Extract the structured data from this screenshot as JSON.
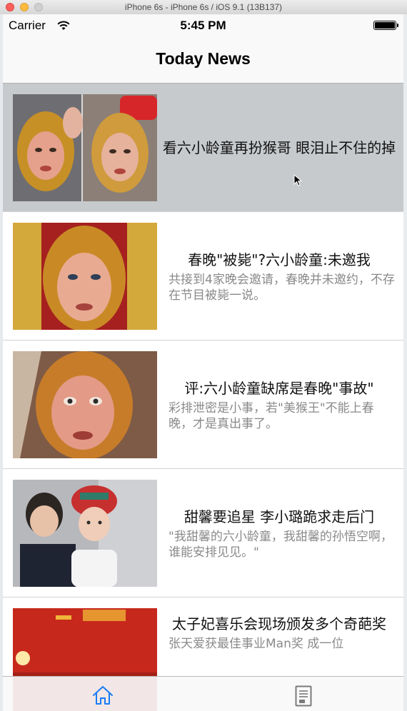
{
  "window": {
    "title": "iPhone 6s - iPhone 6s / iOS 9.1 (13B137)"
  },
  "status_bar": {
    "carrier": "Carrier",
    "time": "5:45 PM"
  },
  "nav": {
    "title": "Today News"
  },
  "news": [
    {
      "title": "看六小龄童再扮猴哥 眼泪止不住的掉",
      "summary": "",
      "selected": true,
      "thumbnail": "monkey-king-makeup-split"
    },
    {
      "title": "春晚\"被毙\"?六小龄童:未邀我",
      "summary": "共接到4家晚会邀请，春晚并未邀约，不存在节目被毙一说。",
      "selected": false,
      "thumbnail": "monkey-king-gold-throne"
    },
    {
      "title": "评:六小龄童缺席是春晚\"事故\"",
      "summary": "彩排泄密是小事，若\"美猴王\"不能上春晚，才是真出事了。",
      "selected": false,
      "thumbnail": "monkey-king-closeup"
    },
    {
      "title": "甜馨要追星 李小璐跪求走后门",
      "summary": "\"我甜馨的六小龄童，我甜馨的孙悟空啊，谁能安排见见。\"",
      "selected": false,
      "thumbnail": "child-in-headdress"
    },
    {
      "title": "太子妃喜乐会现场颁发多个奇葩奖",
      "summary": "张天爱获最佳事业Man奖 成一位",
      "selected": false,
      "thumbnail": "red-stage-letv"
    }
  ],
  "tabbar": {
    "tabs": [
      {
        "icon": "home-icon",
        "active": true
      },
      {
        "icon": "document-icon",
        "active": false
      }
    ]
  },
  "colors": {
    "accent": "#1a7cf6",
    "selected_row": "#c7cacd"
  }
}
